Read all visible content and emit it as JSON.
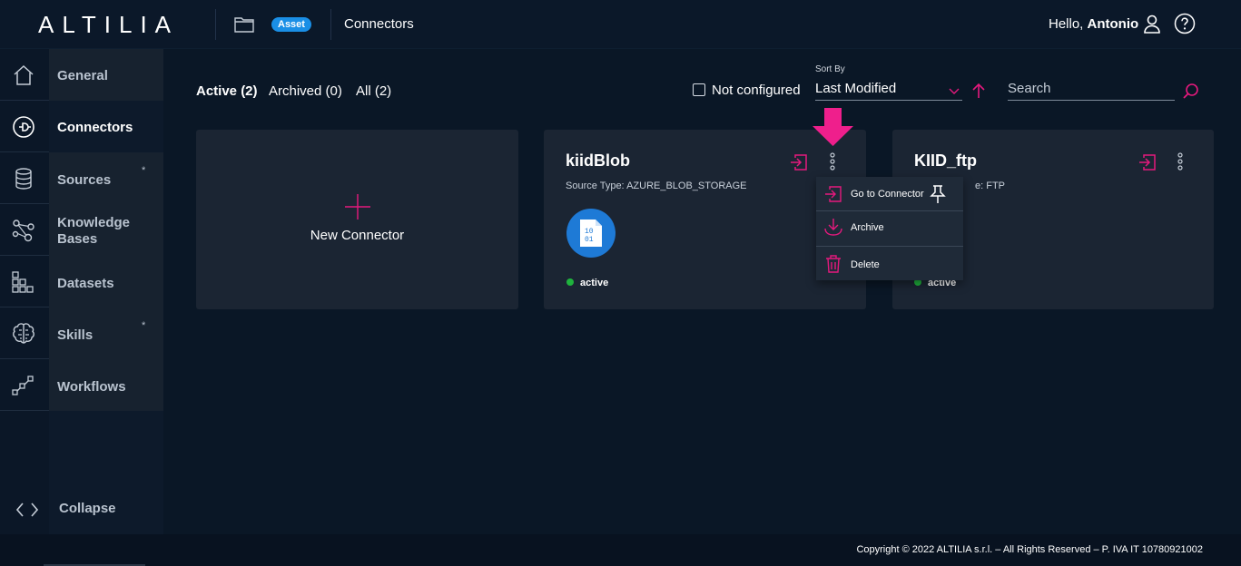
{
  "header": {
    "logo": "ALTILIA",
    "asset_badge": "Asset",
    "title": "Connectors",
    "greeting": "Hello,",
    "user_name": "Antonio"
  },
  "sidebar": {
    "items": [
      {
        "label": "General",
        "icon": "home-icon"
      },
      {
        "label": "Connectors",
        "icon": "plug-icon",
        "active": true
      },
      {
        "label": "Sources",
        "icon": "database-icon",
        "star": "*"
      },
      {
        "label": "Knowledge Bases",
        "icon": "graph-icon"
      },
      {
        "label": "Datasets",
        "icon": "grid-icon"
      },
      {
        "label": "Skills",
        "icon": "brain-icon",
        "star": "*"
      },
      {
        "label": "Workflows",
        "icon": "workflow-icon"
      }
    ],
    "collapse_label": "Collapse"
  },
  "toolbar": {
    "tabs": [
      "Active (2)",
      "Archived (0)",
      "All (2)"
    ],
    "not_configured_label": "Not configured",
    "sort_by_label": "Sort By",
    "sort_by_value": "Last Modified",
    "search_placeholder": "Search"
  },
  "cards": {
    "new_connector_label": "New Connector",
    "connectors": [
      {
        "name": "kiidBlob",
        "source_type": "Source Type: AZURE_BLOB_STORAGE",
        "status": "active",
        "icon_text": "10\n01"
      },
      {
        "name": "KIID_ftp",
        "source_type_visible": "e: FTP",
        "status": "active"
      }
    ]
  },
  "menu": {
    "items": [
      {
        "label": "Go to Connector",
        "icon": "enter-icon"
      },
      {
        "label": "Archive",
        "icon": "archive-icon"
      },
      {
        "label": "Delete",
        "icon": "trash-icon"
      }
    ]
  },
  "footer": {
    "copyright": "Copyright © 2022 ALTILIA s.r.l. – All Rights Reserved – P. IVA IT 10780921002"
  },
  "colors": {
    "accent": "#e5197d",
    "background": "#0a1726",
    "card": "#1b2533",
    "status_active": "#1fb33d",
    "badge": "#1a8fe6"
  }
}
